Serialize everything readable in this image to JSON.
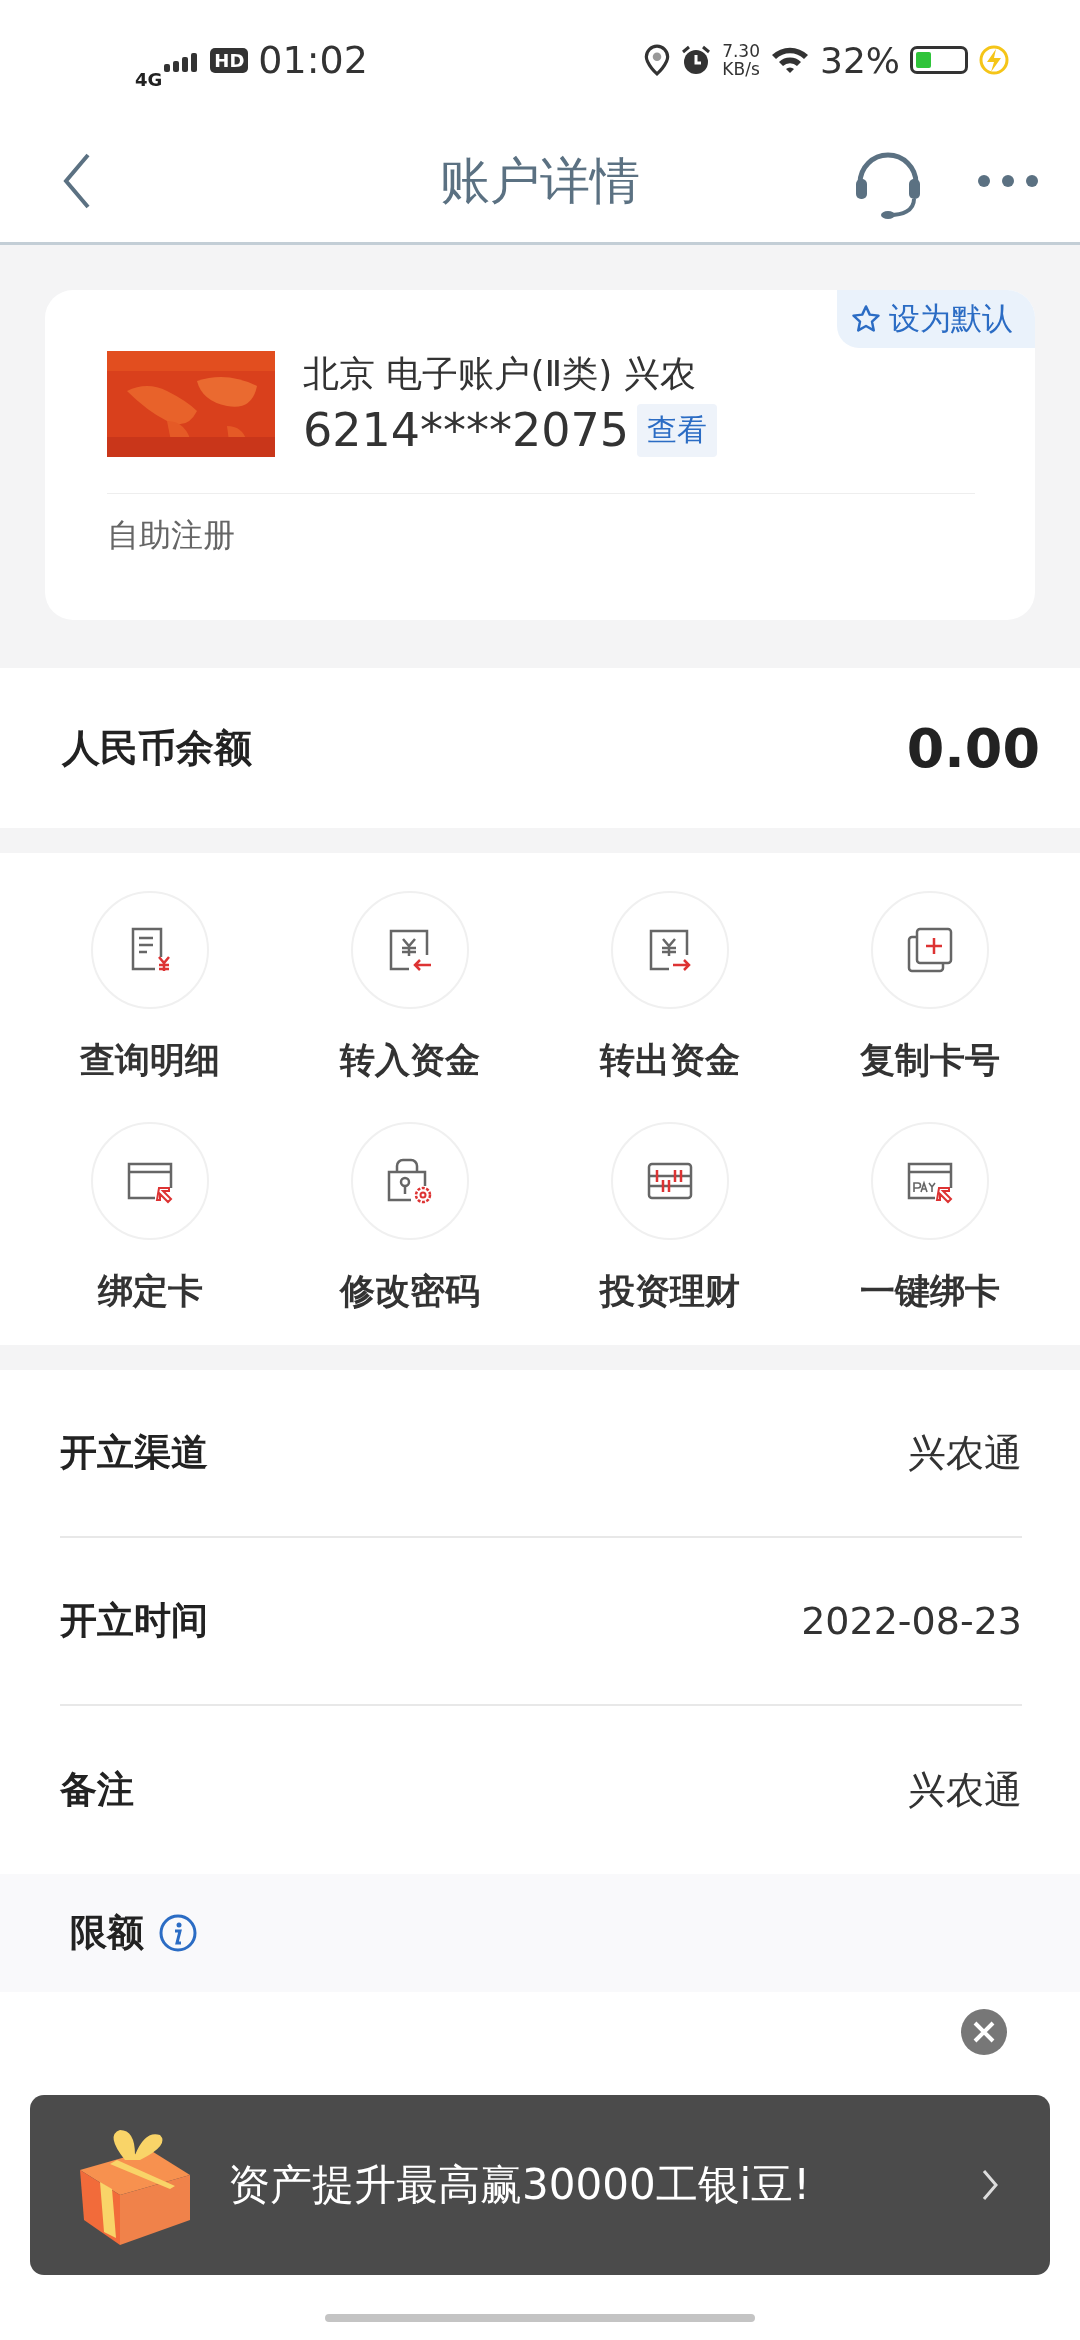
{
  "status_bar": {
    "network": "4G",
    "hd": "HD",
    "time": "01:02",
    "speed_value": "7.30",
    "speed_unit": "KB/s",
    "battery": "32%"
  },
  "header": {
    "title": "账户详情"
  },
  "account_card": {
    "default_button": "设为默认",
    "name": "北京 电子账户(Ⅱ类) 兴农",
    "number": "6214****2075",
    "view_button": "查看",
    "footer": "自助注册"
  },
  "balance": {
    "label": "人民币余额",
    "value": "0.00"
  },
  "actions": [
    {
      "kind": "detail",
      "label": "查询明细"
    },
    {
      "kind": "transfer-in",
      "label": "转入资金"
    },
    {
      "kind": "transfer-out",
      "label": "转出资金"
    },
    {
      "kind": "copy",
      "label": "复制卡号"
    },
    {
      "kind": "bind",
      "label": "绑定卡"
    },
    {
      "kind": "password",
      "label": "修改密码"
    },
    {
      "kind": "invest",
      "label": "投资理财"
    },
    {
      "kind": "pay",
      "label": "一键绑卡"
    }
  ],
  "info_rows": [
    {
      "label": "开立渠道",
      "value": "兴农通"
    },
    {
      "label": "开立时间",
      "value": "2022-08-23"
    },
    {
      "label": "备注",
      "value": "兴农通"
    }
  ],
  "limits": {
    "title": "限额"
  },
  "promo_banner": {
    "text": "资产提升最高赢30000工银i豆!"
  }
}
